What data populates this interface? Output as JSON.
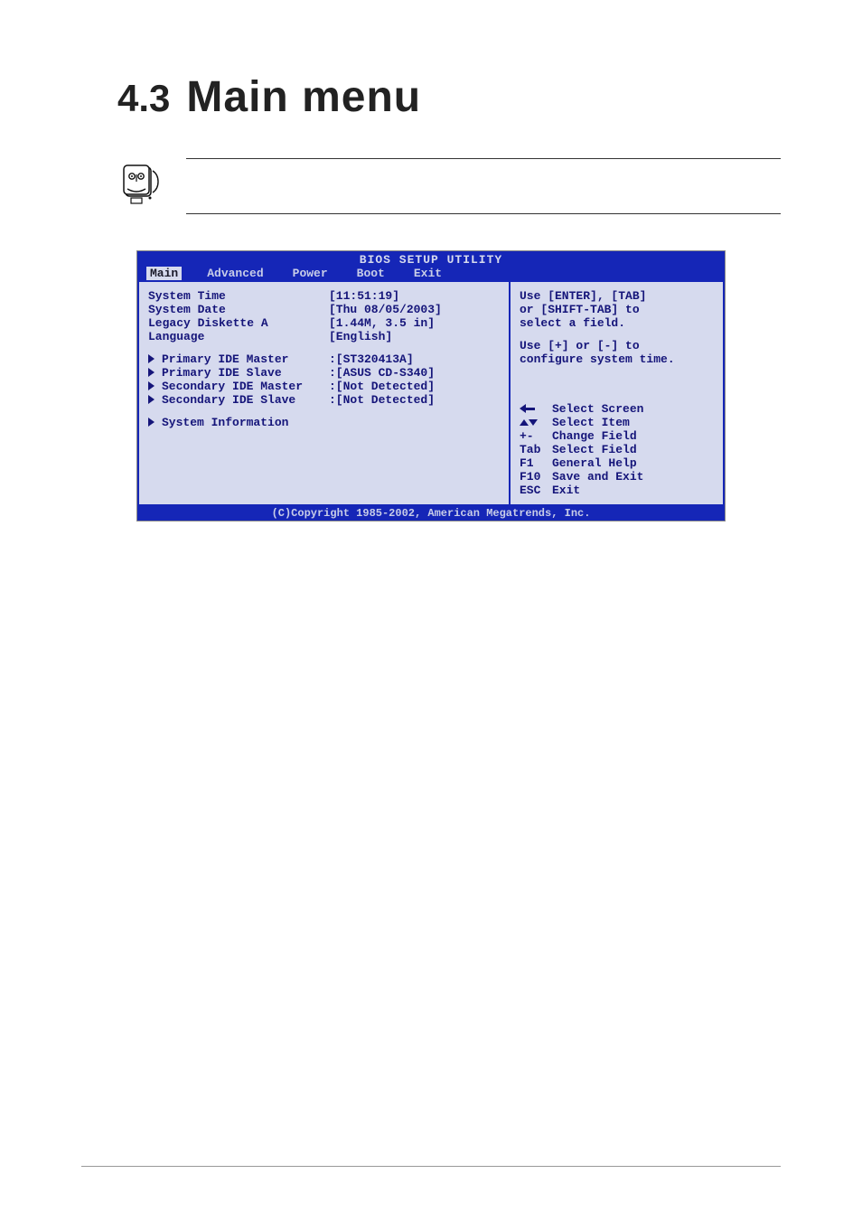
{
  "heading": {
    "number": "4.3",
    "title": "Main menu"
  },
  "note": {
    "text": ""
  },
  "bios": {
    "title": "BIOS SETUP UTILITY",
    "tabs": [
      "Main",
      "Advanced",
      "Power",
      "Boot",
      "Exit"
    ],
    "selected_tab_index": 0,
    "fields": {
      "system_time": {
        "label": "System Time",
        "value": "[11:51:19]"
      },
      "system_date": {
        "label": "System Date",
        "value": "[Thu 08/05/2003]"
      },
      "legacy_diskette_a": {
        "label": "Legacy Diskette A",
        "value": "[1.44M, 3.5 in]"
      },
      "language": {
        "label": "Language",
        "value": "[English]"
      }
    },
    "submenus": [
      {
        "label": "Primary IDE Master",
        "value": ":[ST320413A]"
      },
      {
        "label": "Primary IDE Slave",
        "value": ":[ASUS CD-S340]"
      },
      {
        "label": "Secondary IDE Master",
        "value": ":[Not Detected]"
      },
      {
        "label": "Secondary IDE Slave",
        "value": ":[Not Detected]"
      }
    ],
    "extra_submenu": {
      "label": "System Information"
    },
    "help": {
      "line1": "Use [ENTER], [TAB]",
      "line2": "or [SHIFT-TAB] to",
      "line3": "select a field.",
      "line4": "Use [+] or [-] to",
      "line5": "configure system time."
    },
    "keys": [
      {
        "icon": "left-arrow",
        "key": "",
        "desc": "Select Screen"
      },
      {
        "icon": "updown-arrow",
        "key": "",
        "desc": "Select Item"
      },
      {
        "icon": "",
        "key": "+-",
        "desc": "Change Field"
      },
      {
        "icon": "",
        "key": "Tab",
        "desc": "Select Field"
      },
      {
        "icon": "",
        "key": "F1",
        "desc": "General Help"
      },
      {
        "icon": "",
        "key": "F10",
        "desc": "Save and Exit"
      },
      {
        "icon": "",
        "key": "ESC",
        "desc": "Exit"
      }
    ],
    "copyright": "(C)Copyright 1985-2002, American Megatrends, Inc."
  }
}
